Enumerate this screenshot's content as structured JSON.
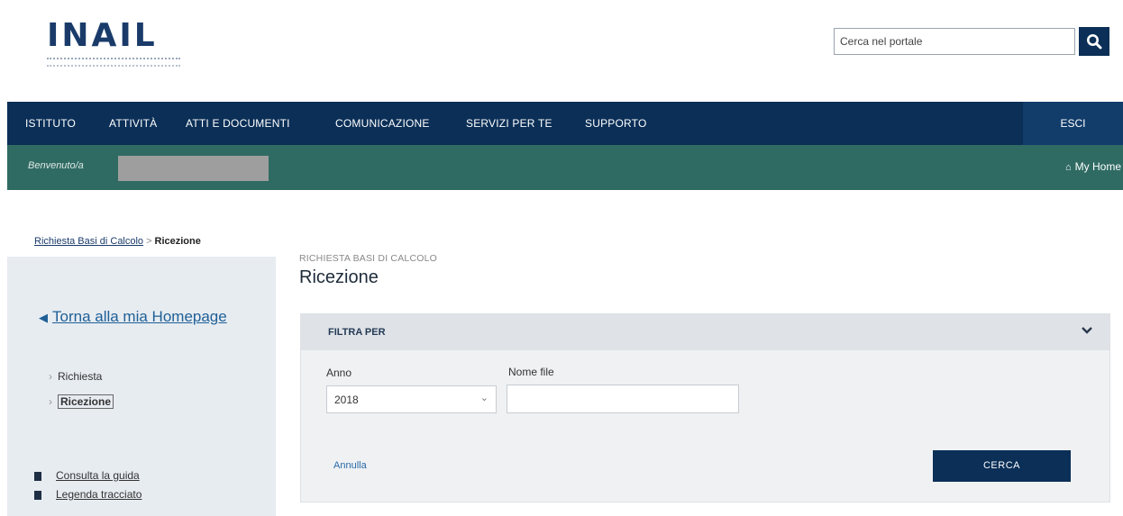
{
  "header": {
    "logo_text": "INAIL",
    "logo_subtitle": "ISTITUTO NAZIONALE PER L'ASSICURAZIONE CONTRO GLI INFORTUNI SUL LAVORO",
    "search_placeholder": "Cerca nel portale",
    "search_icon": "search-icon"
  },
  "nav": {
    "items": [
      "ISTITUTO",
      "ATTIVITÀ",
      "ATTI E DOCUMENTI",
      "COMUNICAZIONE",
      "SERVIZI PER TE",
      "SUPPORTO"
    ],
    "logout": "ESCI"
  },
  "subnav": {
    "welcome": "Benvenuto/a",
    "myhome": "My Home",
    "home_icon": "home-icon"
  },
  "breadcrumb": {
    "parent": "Richiesta Basi di Calcolo",
    "separator": ">",
    "current": "Ricezione"
  },
  "sidebar": {
    "back_link": "Torna alla mia Homepage",
    "items": [
      {
        "label": "Richiesta",
        "active": false
      },
      {
        "label": "Ricezione",
        "active": true
      }
    ],
    "docs": [
      "Consulta la guida",
      "Legenda tracciato"
    ]
  },
  "main": {
    "kicker": "RICHIESTA BASI DI CALCOLO",
    "title": "Ricezione",
    "filter": {
      "title": "FILTRA PER",
      "anno_label": "Anno",
      "anno_value": "2018",
      "nome_file_label": "Nome file",
      "nome_file_value": "",
      "annulla": "Annulla",
      "cerca": "CERCA"
    }
  },
  "colors": {
    "nav_bg": "#0b2f57",
    "subnav_bg": "#2f6b63",
    "sidebar_bg": "#e7ecf1",
    "panel_bg": "#eff1f3"
  }
}
